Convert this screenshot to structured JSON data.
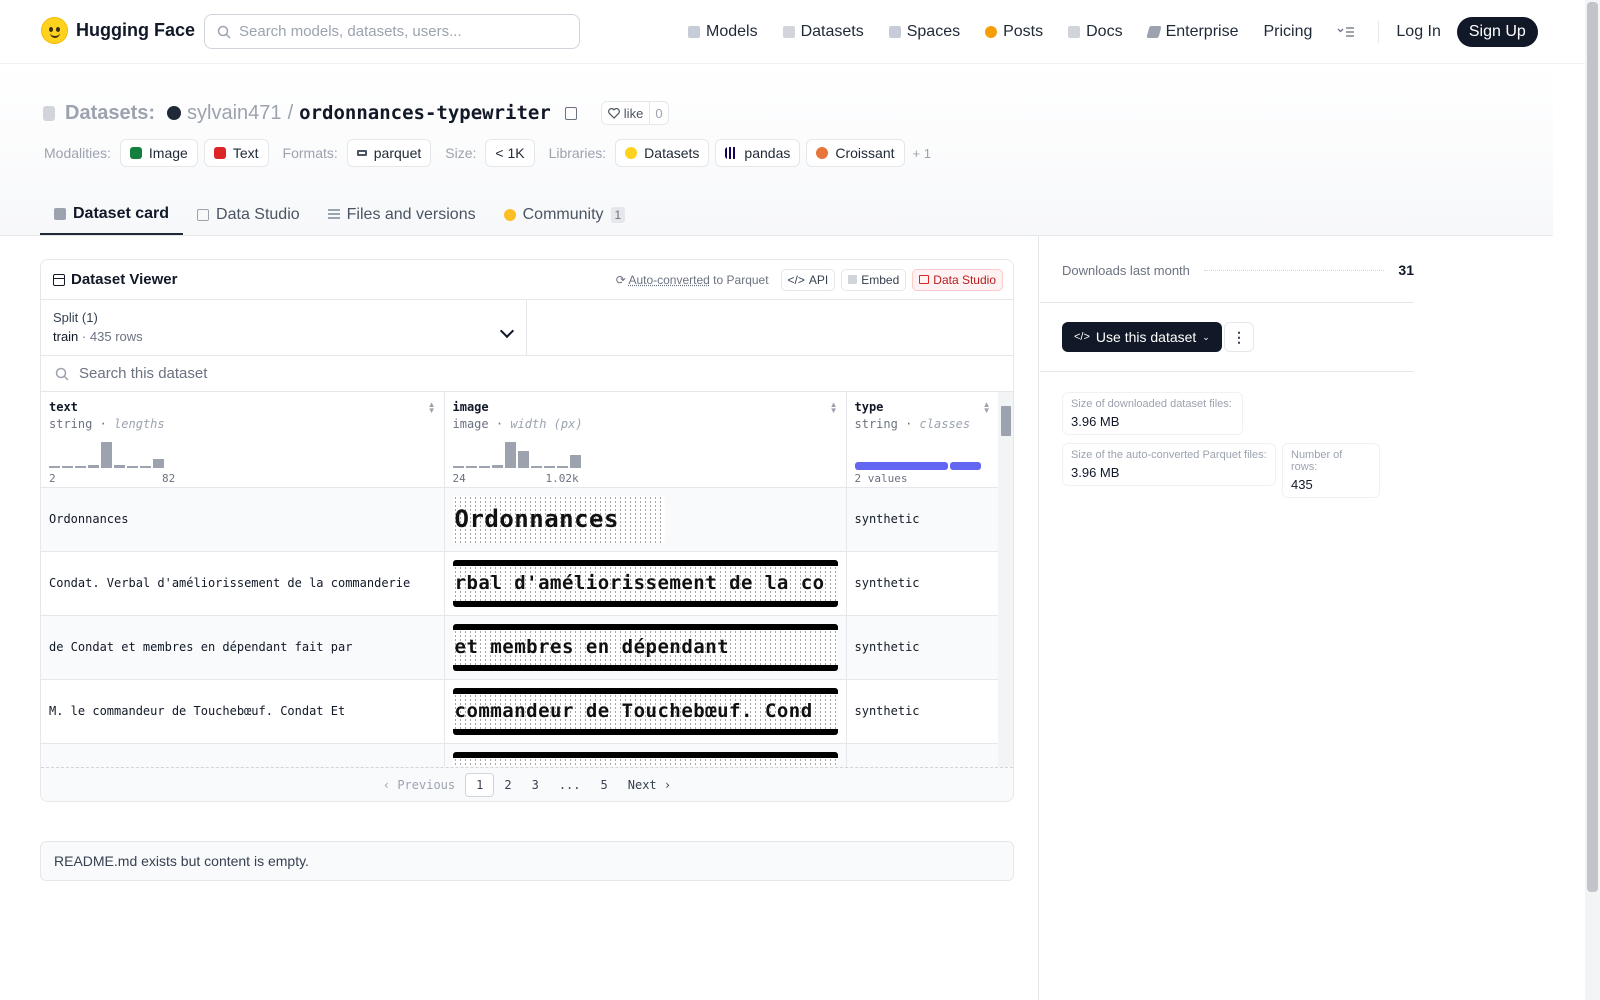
{
  "nav": {
    "brand": "Hugging Face",
    "search_placeholder": "Search models, datasets, users...",
    "links": [
      "Models",
      "Datasets",
      "Spaces",
      "Posts",
      "Docs",
      "Enterprise",
      "Pricing"
    ],
    "login": "Log In",
    "signup": "Sign Up"
  },
  "header": {
    "section": "Datasets:",
    "owner": "sylvain471",
    "slash": "/",
    "repo": "ordonnances-typewriter",
    "like_label": "like",
    "like_count": "0",
    "modalities_label": "Modalities:",
    "modalities": [
      "Image",
      "Text"
    ],
    "formats_label": "Formats:",
    "format": "parquet",
    "size_label": "Size:",
    "size": "< 1K",
    "libraries_label": "Libraries:",
    "libraries": [
      "Datasets",
      "pandas",
      "Croissant"
    ],
    "more": "+ 1"
  },
  "tabs": [
    {
      "label": "Dataset card"
    },
    {
      "label": "Data Studio"
    },
    {
      "label": "Files and versions"
    },
    {
      "label": "Community",
      "badge": "1"
    }
  ],
  "viewer": {
    "title": "Dataset Viewer",
    "auto_converted": "Auto-converted",
    "to_parquet": "to Parquet",
    "api": "API",
    "embed": "Embed",
    "data_studio": "Data Studio",
    "split_label": "Split (1)",
    "split_name": "train",
    "split_sep": "·",
    "split_rows": "435 rows",
    "search_placeholder": "Search this dataset",
    "columns": [
      {
        "name": "text",
        "type": "string",
        "stat": "lengths",
        "min": "2",
        "max": "82",
        "hist": [
          0.08,
          0.08,
          0.08,
          0.12,
          1.0,
          0.12,
          0.08,
          0.08,
          0.35
        ]
      },
      {
        "name": "image",
        "type": "image",
        "stat": "width (px)",
        "min": "24",
        "max": "1.02k",
        "hist": [
          0.08,
          0.08,
          0.08,
          0.12,
          1.0,
          0.65,
          0.08,
          0.08,
          0.08,
          0.5
        ]
      },
      {
        "name": "type",
        "type": "string",
        "stat": "classes",
        "classes_label": "2 values",
        "class_share": [
          0.74,
          0.26
        ]
      }
    ],
    "rows": [
      {
        "text": "Ordonnances",
        "image_text": "Ordonnances",
        "type": "synthetic"
      },
      {
        "text": "Condat. Verbal d'améliorissement de la commanderie",
        "image_text": "rbal d'améliorissement de la co",
        "type": "synthetic"
      },
      {
        "text": "de Condat et membres en dépendant fait par",
        "image_text": "et membres en dépendant",
        "type": "synthetic"
      },
      {
        "text": "M. le commandeur de Touchebœuf. Condat Et",
        "image_text": "commandeur de Touchebœuf. Cond",
        "type": "synthetic"
      },
      {
        "text": "",
        "image_text": "",
        "type": ""
      }
    ],
    "pager": {
      "previous": "Previous",
      "pages": [
        "1",
        "2",
        "3",
        "...",
        "5"
      ],
      "next": "Next"
    }
  },
  "readme": "README.md exists but content is empty.",
  "sidebar": {
    "downloads_label": "Downloads last month",
    "downloads": "31",
    "use_button": "Use this dataset",
    "stats": [
      {
        "label": "Size of downloaded dataset files:",
        "value": "3.96 MB"
      },
      {
        "label": "Size of the auto-converted Parquet files:",
        "value": "3.96 MB"
      },
      {
        "label": "Number of rows:",
        "value": "435"
      }
    ]
  },
  "colors": {
    "accent": "#6366f1",
    "brand_yellow": "#ffd21e",
    "dark": "#111827"
  }
}
